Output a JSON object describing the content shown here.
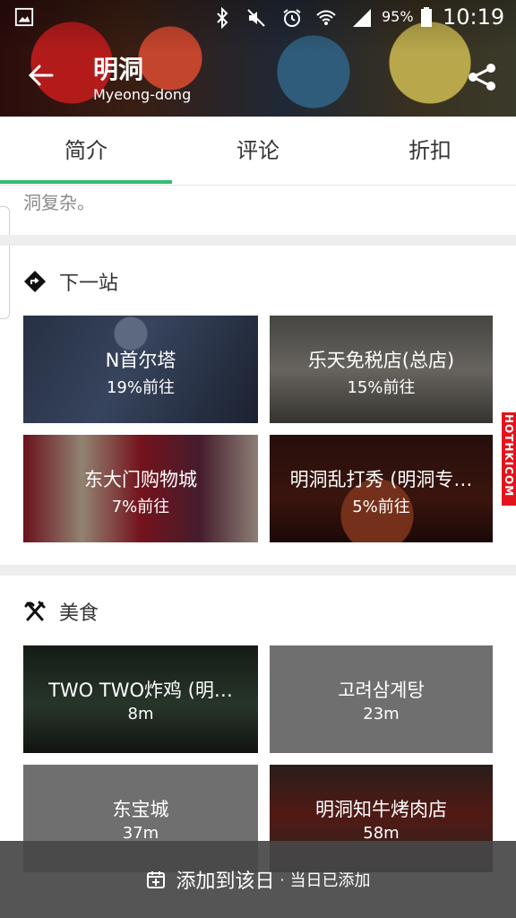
{
  "status_bar": {
    "battery_percent": "95%",
    "time": "10:19"
  },
  "header": {
    "title": "明洞",
    "subtitle": "Myeong-dong"
  },
  "tabs": [
    {
      "label": "简介"
    },
    {
      "label": "评论"
    },
    {
      "label": "折扣"
    }
  ],
  "intro": {
    "truncated_text": "洞复杂。"
  },
  "next_stop": {
    "title": "下一站",
    "items": [
      {
        "name": "N首尔塔",
        "sub": "19%前往"
      },
      {
        "name": "乐天免税店(总店)",
        "sub": "15%前往"
      },
      {
        "name": "东大门购物城",
        "sub": "7%前往"
      },
      {
        "name": "明洞乱打秀 (明洞专…",
        "sub": "5%前往"
      }
    ]
  },
  "food": {
    "title": "美食",
    "items": [
      {
        "name": "TWO TWO炸鸡 (明…",
        "sub": "8m"
      },
      {
        "name": "고려삼계탕",
        "sub": "23m"
      },
      {
        "name": "东宝城",
        "sub": "37m"
      },
      {
        "name": "明洞知牛烤肉店",
        "sub": "58m"
      }
    ]
  },
  "side_badge": {
    "text": "HOTHKICOM"
  },
  "bottom_bar": {
    "add_label": "添加到该日",
    "separator": "·",
    "status_text": "当日已添加"
  }
}
